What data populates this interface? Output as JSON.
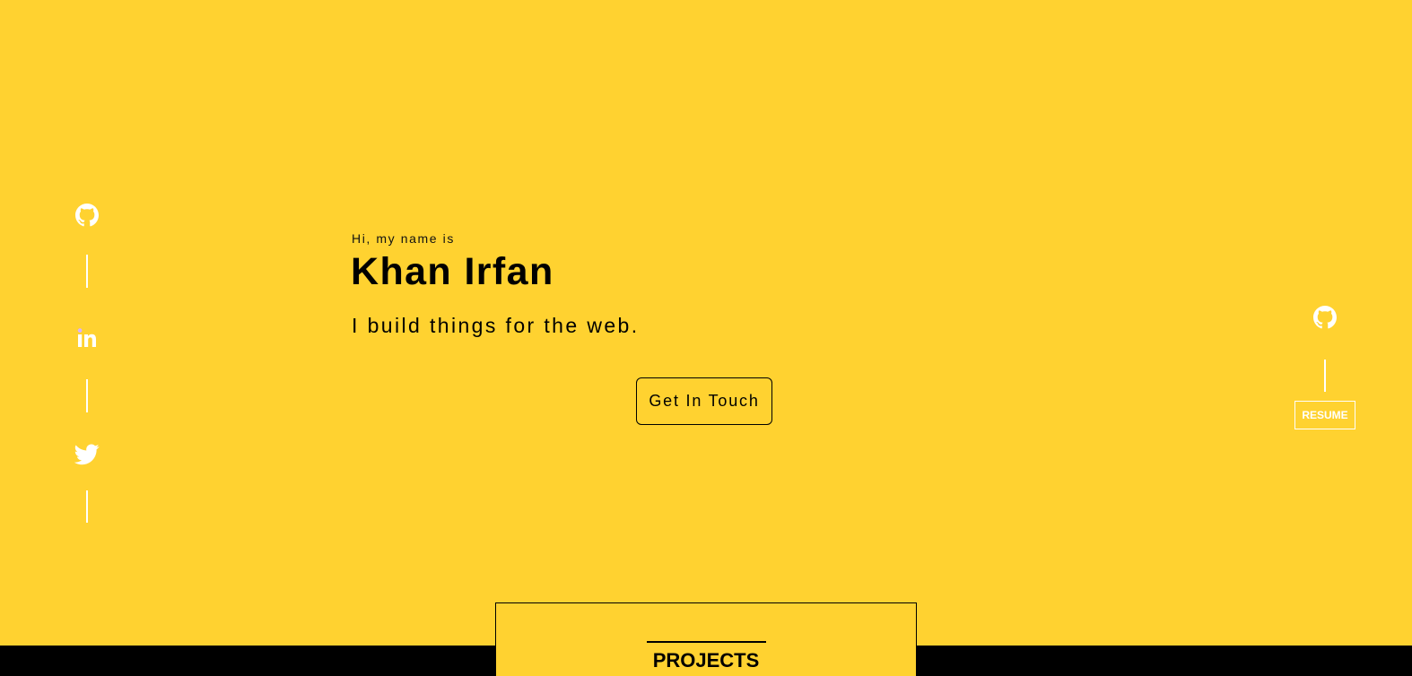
{
  "social_left": {
    "items": [
      {
        "name": "github",
        "icon": "github-icon"
      },
      {
        "name": "linkedin",
        "icon": "linkedin-icon"
      },
      {
        "name": "twitter",
        "icon": "twitter-icon"
      }
    ]
  },
  "hero": {
    "greeting": "Hi, my name is",
    "name": "Khan Irfan",
    "tagline": "I build things for the web.",
    "cta_label": "Get In Touch"
  },
  "social_right": {
    "icon": "github-icon",
    "resume_label": "RESUME"
  },
  "projects": {
    "title": "PROJECTS"
  },
  "colors": {
    "background": "#FFD230",
    "text": "#000000",
    "rail": "#FFFFFF",
    "band": "#000000"
  }
}
